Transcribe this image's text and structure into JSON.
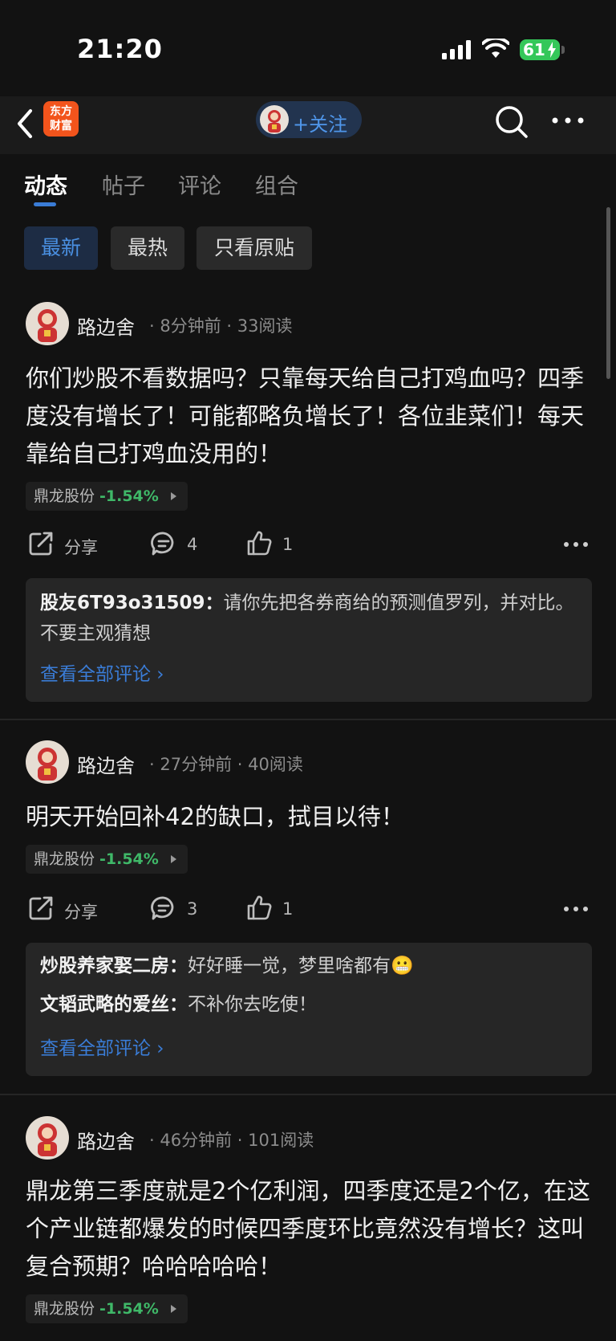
{
  "status": {
    "time": "21:20",
    "battery": "61"
  },
  "nav": {
    "logo": "东方财富",
    "follow_label": "+关注"
  },
  "tabs": [
    "动态",
    "帖子",
    "评论",
    "组合"
  ],
  "filters": [
    "最新",
    "最热",
    "只看原贴"
  ],
  "posts": [
    {
      "author": "路边舍",
      "time": "8分钟前",
      "reads": "33阅读",
      "content": "你们炒股不看数据吗？只靠每天给自己打鸡血吗？四季度没有增长了！可能都略负增长了！各位韭菜们！每天靠给自己打鸡血没用的！",
      "stock_name": "鼎龙股份",
      "stock_change": "-1.54%",
      "share": "分享",
      "comments": "4",
      "likes": "1",
      "replies": [
        {
          "user": "股友6T93o31509",
          "text": "请你先把各券商给的预测值罗列，并对比。不要主观猜想"
        }
      ],
      "view_all": "查看全部评论"
    },
    {
      "author": "路边舍",
      "time": "27分钟前",
      "reads": "40阅读",
      "content": "明天开始回补42的缺口，拭目以待！",
      "stock_name": "鼎龙股份",
      "stock_change": "-1.54%",
      "share": "分享",
      "comments": "3",
      "likes": "1",
      "replies": [
        {
          "user": "炒股养家娶二房",
          "text": "好好睡一觉，梦里啥都有😬"
        },
        {
          "user": "文韬武略的爱丝",
          "text": "不补你去吃使！"
        }
      ],
      "view_all": "查看全部评论"
    },
    {
      "author": "路边舍",
      "time": "46分钟前",
      "reads": "101阅读",
      "content": "鼎龙第三季度就是2个亿利润，四季度还是2个亿，在这个产业链都爆发的时候四季度环比竟然没有增长？这叫复合预期？哈哈哈哈哈！",
      "stock_name": "鼎龙股份",
      "stock_change": "-1.54%"
    }
  ],
  "colors": {
    "accent": "#3a7cd6",
    "down": "#3fb868",
    "brand": "#f2541c",
    "battery": "#34c759"
  }
}
